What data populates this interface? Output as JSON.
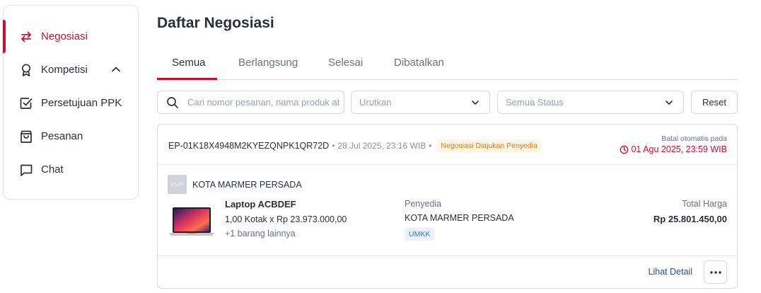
{
  "sidebar": {
    "items": [
      {
        "label": "Negosiasi",
        "icon": "swap-arrows-icon",
        "active": true
      },
      {
        "label": "Kompetisi",
        "icon": "award-ribbon-icon",
        "expanded": true
      },
      {
        "label": "Persetujuan PPK",
        "icon": "checkbox-icon"
      },
      {
        "label": "Pesanan",
        "icon": "shopping-bag-icon"
      },
      {
        "label": "Chat",
        "icon": "chat-bubble-icon"
      }
    ]
  },
  "main": {
    "title": "Daftar Negosiasi",
    "tabs": [
      {
        "label": "Semua",
        "active": true
      },
      {
        "label": "Berlangsung"
      },
      {
        "label": "Selesai"
      },
      {
        "label": "Dibatalkan"
      }
    ],
    "filters": {
      "search_placeholder": "Cari nomor pesanan, nama produk atau nama penyedia",
      "sort_placeholder": "Urutkan",
      "status_placeholder": "Semua Status",
      "reset_label": "Reset"
    },
    "order": {
      "id": "EP-01K18X4948M2KYEZQNPK1QR72D",
      "date": "28 Jul 2025, 23:16 WIB",
      "status": "Negosiasi Diajukan Penyedia",
      "cancel_label": "Batal otomatis pada",
      "cancel_deadline": "01 Agu 2025, 23:59 WIB",
      "seller_initials": "KMP",
      "seller_name": "KOTA MARMER PERSADA",
      "product_name": "Laptop ACBDEF",
      "product_qty": "1,00 Kotak x Rp 23.973.000,00",
      "product_more": "+1 barang lainnya",
      "provider_label": "Penyedia",
      "provider_name": "KOTA MARMER PERSADA",
      "provider_badge": "UMKK",
      "total_label": "Total Harga",
      "total_value": "Rp 25.801.450,00",
      "detail_link": "Lihat Detail"
    }
  },
  "colors": {
    "accent": "#c8102e",
    "status_orange": "#e07a00",
    "link_blue": "#1f4ea8",
    "badge_blue": "#2f74d0"
  }
}
